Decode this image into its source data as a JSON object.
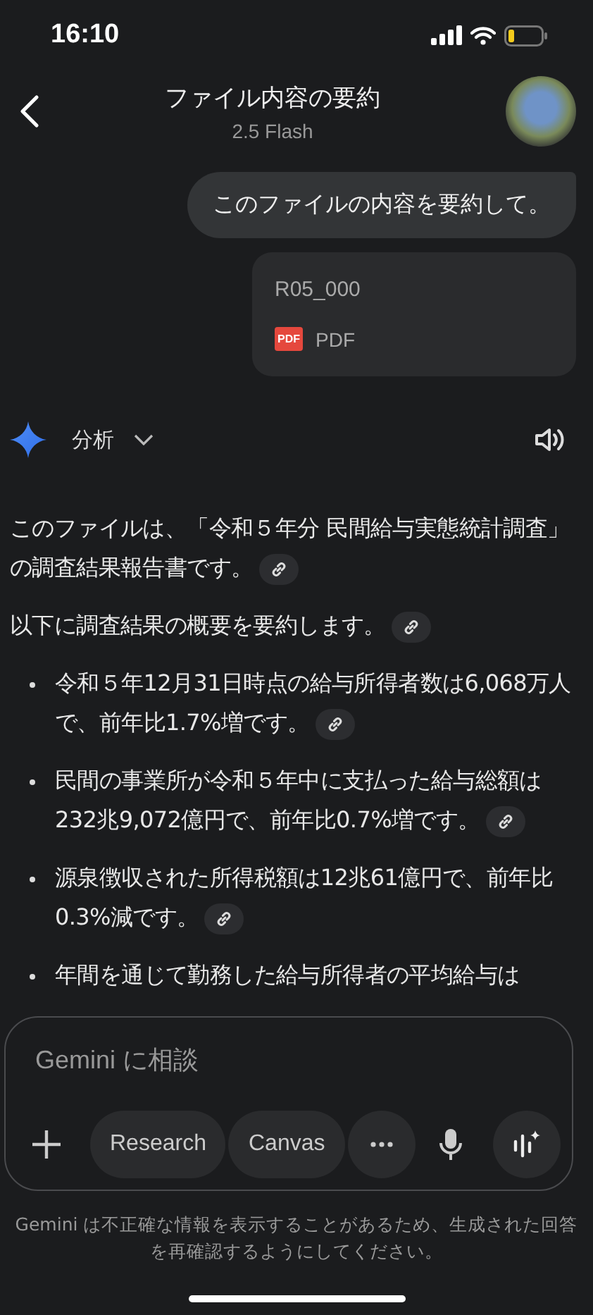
{
  "status_bar": {
    "time": "16:10"
  },
  "header": {
    "title": "ファイル内容の要約",
    "subtitle": "2.5 Flash"
  },
  "user_message": {
    "text": "このファイルの内容を要約して。"
  },
  "attachment": {
    "name": "R05_000",
    "badge": "PDF",
    "type": "PDF"
  },
  "response": {
    "mode": "分析",
    "blocks": [
      {
        "kind": "paragraph",
        "text": "このファイルは、「令和５年分 民間給与実態統計調査」の調査結果報告書です。",
        "source_link": true
      },
      {
        "kind": "paragraph",
        "text": "以下に調査結果の概要を要約します。",
        "source_link": true
      },
      {
        "kind": "bullet",
        "text": "令和５年12月31日時点の給与所得者数は6,068万人で、前年比1.7%増です。",
        "source_link": true
      },
      {
        "kind": "bullet",
        "text": "民間の事業所が令和５年中に支払った給与総額は232兆9,072億円で、前年比0.7%増です。",
        "source_link": true
      },
      {
        "kind": "bullet",
        "text": "源泉徴収された所得税額は12兆61億円で、前年比0.3%減です。",
        "source_link": true
      },
      {
        "kind": "bullet",
        "text": "年間を通じて勤務した給与所得者の平均給与は",
        "source_link": false
      }
    ]
  },
  "composer": {
    "placeholder": "Gemini に相談",
    "chips": [
      "Research",
      "Canvas"
    ]
  },
  "disclaimer": "Gemini は不正確な情報を表示することがあるため、生成された回答を再確認するようにしてください。"
}
